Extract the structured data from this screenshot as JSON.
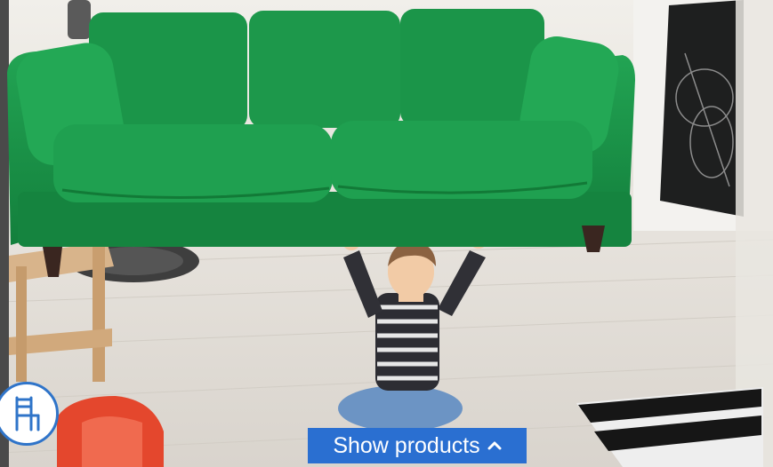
{
  "overlay": {
    "show_products_label": "Show products"
  },
  "icons": {
    "catalog": "chair-icon",
    "show_products": "chevron-up-icon"
  },
  "colors": {
    "sofa": "#1f9a49",
    "button": "#2a6fd1",
    "chair": "#e4472d"
  }
}
